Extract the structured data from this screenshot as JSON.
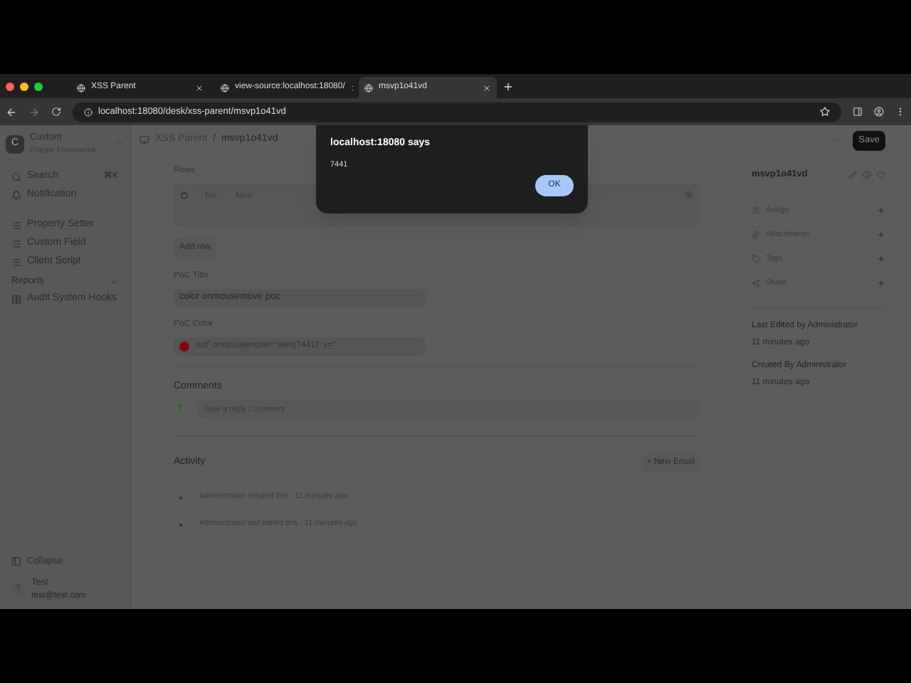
{
  "browser": {
    "tabs": [
      {
        "title": "XSS Parent",
        "selected": false
      },
      {
        "title": "view-source:localhost:18080/",
        "selected": false
      },
      {
        "title": "msvp1o41vd",
        "selected": true
      }
    ],
    "url": "localhost:18080/desk/xss-parent/msvp1o41vd"
  },
  "sidebar": {
    "app": {
      "logo": "C",
      "name": "Custom",
      "subtitle": "Frappe Framework"
    },
    "items": [
      {
        "kind": "search",
        "label": "Search",
        "shortcut": "⌘K"
      },
      {
        "kind": "notification",
        "label": "Notification"
      },
      {
        "kind": "list",
        "label": "Property Setter"
      },
      {
        "kind": "list",
        "label": "Custom Field"
      },
      {
        "kind": "list",
        "label": "Client Script"
      },
      {
        "kind": "section",
        "label": "Reports"
      },
      {
        "kind": "report",
        "label": "Audit System Hooks"
      }
    ],
    "collapse": "Collapse",
    "user": {
      "initial": "T",
      "name": "Test",
      "email": "test@test.com"
    }
  },
  "breadcrumbs": [
    "XSS Parent",
    "msvp1o41vd"
  ],
  "breadcrumb_separator": "/",
  "actions": {
    "more": "···",
    "save": "Save"
  },
  "rows_table": {
    "label": "Rows",
    "columns": [
      "No.",
      "Now"
    ],
    "select_all_checked": false,
    "add_row": "Add row"
  },
  "fields": [
    {
      "kind": "text",
      "label": "PoC Title",
      "value": "color onmousemove poc"
    },
    {
      "kind": "color",
      "label": "PoC Color",
      "value": "red\" onmousemove=\"alert(7441)\" x=\"",
      "color": "#7a0b0b"
    }
  ],
  "comments": {
    "title": "Comments",
    "avatar": "T",
    "placeholder": "Type a reply / comment"
  },
  "activity": {
    "title": "Activity",
    "new_email": "+ New Email",
    "items": [
      "Administrator created this · 11 minutes ago",
      "Administrator last edited this · 11 minutes ago"
    ]
  },
  "side_panel": {
    "title": "msvp1o41vd",
    "items": [
      "Assign",
      "Attachments",
      "Tags",
      "Share"
    ],
    "meta": [
      "Last Edited by Administrator",
      "11 minutes ago",
      "Created By Administrator",
      "11 minutes ago"
    ]
  },
  "dialog": {
    "title": "localhost:18080 says",
    "message": "7441",
    "button": "OK"
  }
}
